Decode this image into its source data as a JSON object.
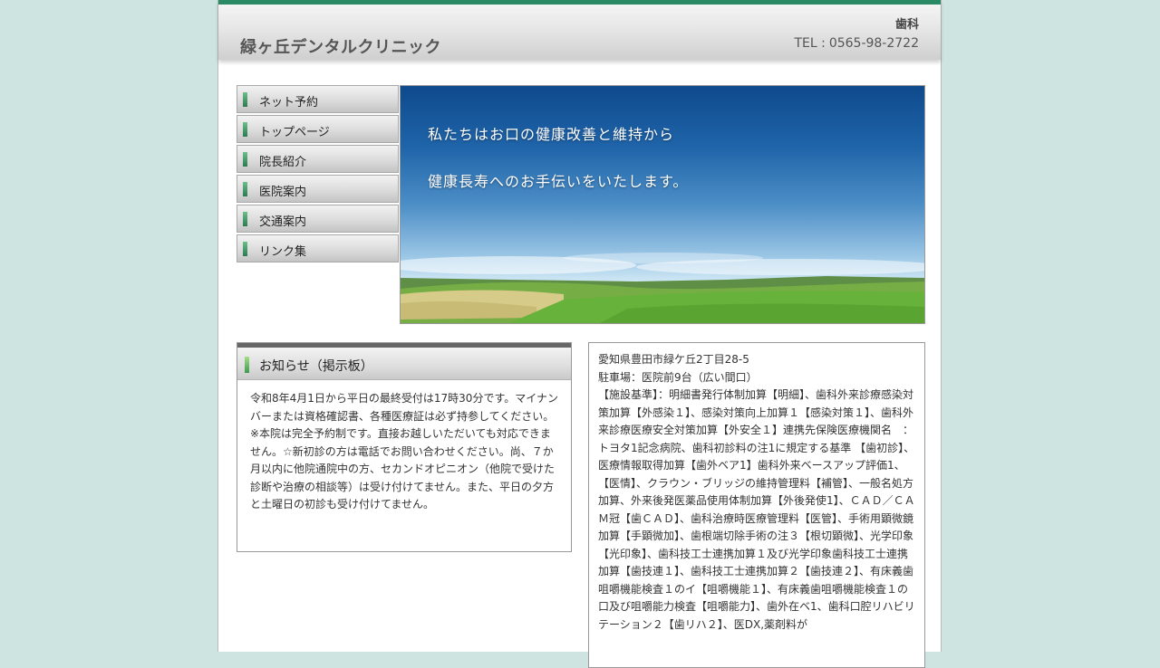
{
  "header": {
    "clinic_name": "緑ヶ丘デンタルクリニック",
    "category": "歯科",
    "tel_label": "TEL :",
    "tel": "0565-98-2722"
  },
  "nav": {
    "items": [
      {
        "label": "ネット予約"
      },
      {
        "label": "トップページ"
      },
      {
        "label": "院長紹介"
      },
      {
        "label": "医院案内"
      },
      {
        "label": "交通案内"
      },
      {
        "label": "リンク集"
      }
    ]
  },
  "hero": {
    "line1": "私たちはお口の健康改善と維持から",
    "line2": "健康長寿へのお手伝いをいたします。"
  },
  "notice": {
    "title": "お知らせ（掲示板）",
    "body": "令和8年4月1日から平日の最終受付は17時30分です。マイナンバーまたは資格確認書、各種医療証は必ず持参してください。※本院は完全予約制です。直接お越しいただいても対応できません。☆新初診の方は電話でお問い合わせください。尚、７か月以内に他院通院中の方、セカンドオピニオン（他院で受けた診断や治療の相談等）は受け付けてません。また、平日の夕方と土曜日の初診も受け付けてません。"
  },
  "info": {
    "address": "愛知県豊田市緑ケ丘2丁目28-5",
    "parking": "駐車場：医院前9台（広い間口）",
    "facility": "【施設基準】：明細書発行体制加算【明細】、歯科外来診療感染対策加算【外感染１】、感染対策向上加算１【感染対策１】、歯科外来診療医療安全対策加算【外安全１】連携先保険医療機関名　：トヨタ1記念病院、歯科初診料の注1に規定する基準 【歯初診】、医療情報取得加算【歯外ベア1】歯科外来ベースアップ評価1、【医情】、クラウン・ブリッジの維持管理料【補管】、一般名処方加算、外来後発医薬品使用体制加算【外後発使1】、ＣＡＤ／ＣＡＭ冠【歯ＣＡＤ】、歯科治療時医療管理料【医管】、手術用顕微鏡加算【手顕微加】、歯根端切除手術の注３【根切顕微】、光学印象【光印象】、歯科技工士連携加算１及び光学印象歯科技工士連携加算【歯技連１】、歯科技工士連携加算２【歯技連２】、有床義歯咀嚼機能検査１のイ【咀嚼機能１】、有床義歯咀嚼機能検査１の口及び咀嚼能力検査【咀嚼能力】、歯外在ベ1、歯科口腔リハビリテーション２【歯リハ２】、医DX,薬剤料が"
  }
}
